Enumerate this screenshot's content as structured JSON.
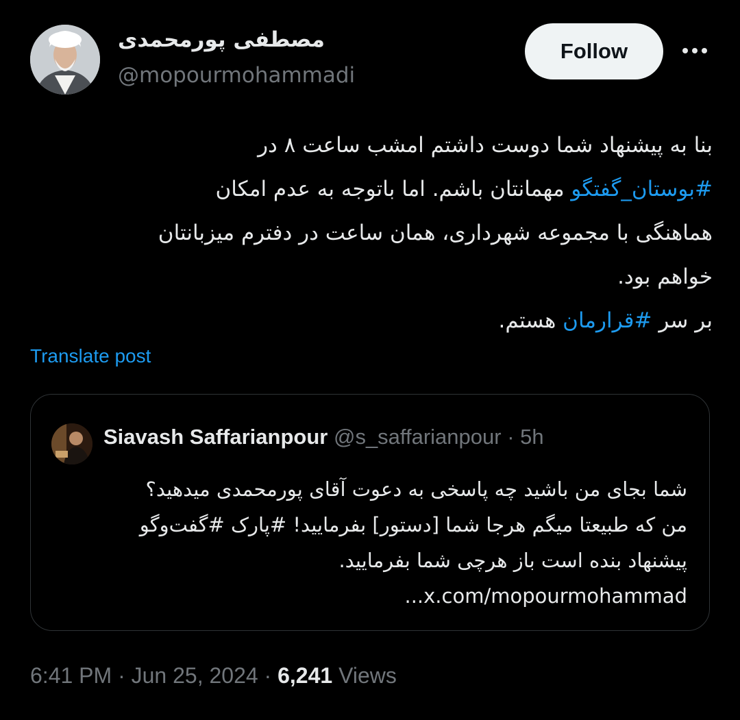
{
  "author": {
    "name": "مصطفی پورمحمدی",
    "handle": "@mopourmohammadi",
    "avatar_icon": "person-avatar"
  },
  "follow_label": "Follow",
  "more_icon": "more-horizontal-icon",
  "tweet": {
    "line1": "بنا به پیشنهاد شما دوست داشتم امشب ساعت ۸ در",
    "line2_hashtag": "#بوستان_گفتگو",
    "line2_rest": " مهمانتان باشم. اما باتوجه به عدم امکان",
    "line3": "هماهنگی با مجموعه شهرداری، همان ساعت در دفترم میزبانتان",
    "line4": "خواهم بود.",
    "line5_pre": "بر سر ",
    "line5_hashtag": "#قرارمان",
    "line5_post": " هستم."
  },
  "translate_label": "Translate post",
  "quote": {
    "name": "Siavash Saffarianpour",
    "handle": "@s_saffarianpour",
    "separator": " · ",
    "time": "5h",
    "line1": "شما بجای من باشید چه پاسخی به دعوت آقای پورمحمدی میدهید؟",
    "line2": "من که طبیعتا میگم هرجا شما [دستور] بفرمایید! #پارک #گفت‌وگو",
    "line3": "پیشنهاد بنده است باز هرچی شما بفرمایید.",
    "line4": "x.com/mopourmohammad..."
  },
  "meta": {
    "time": "6:41 PM",
    "sep1": " · ",
    "date": "Jun 25, 2024",
    "sep2": " · ",
    "views_count": "6,241",
    "views_label": " Views"
  },
  "colors": {
    "background": "#000000",
    "text": "#e7e9ea",
    "muted": "#71767b",
    "link": "#1d9bf0",
    "border": "#2f3336"
  }
}
